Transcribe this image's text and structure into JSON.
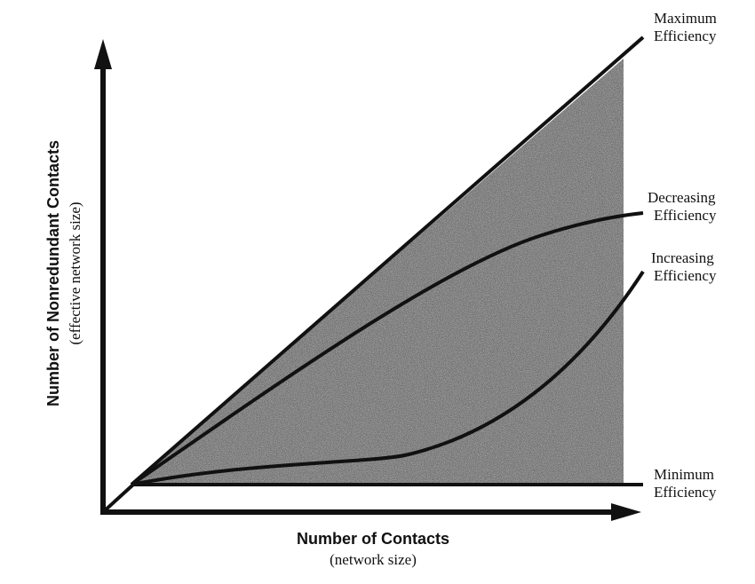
{
  "figure": {
    "y_axis_title": "Number of Nonredundant Contacts",
    "y_axis_subtitle": "(effective network size)",
    "x_axis_title": "Number of Contacts",
    "x_axis_subtitle": "(network size)",
    "curve_labels": {
      "maximum": [
        "Maximum",
        "Efficiency"
      ],
      "decreasing": [
        "Decreasing",
        "Efficiency"
      ],
      "increasing": [
        "Increasing",
        "Efficiency"
      ],
      "minimum": [
        "Minimum",
        "Efficiency"
      ]
    },
    "colors": {
      "ink": "#111111",
      "shaded_region": "#6b6b6b",
      "background": "#ffffff"
    }
  }
}
